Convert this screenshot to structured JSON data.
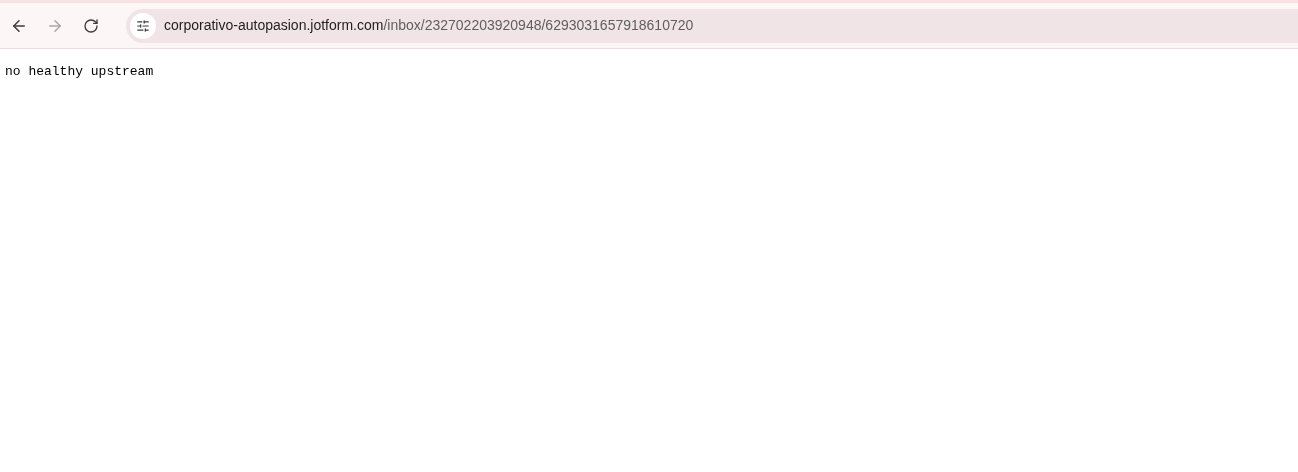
{
  "toolbar": {
    "back": {
      "disabled": false
    },
    "forward": {
      "disabled": true
    },
    "address": {
      "host": "corporativo-autopasion.jotform.com",
      "path": "/inbox/232702203920948/6293031657918610720"
    }
  },
  "page": {
    "body_text": "no healthy upstream"
  }
}
